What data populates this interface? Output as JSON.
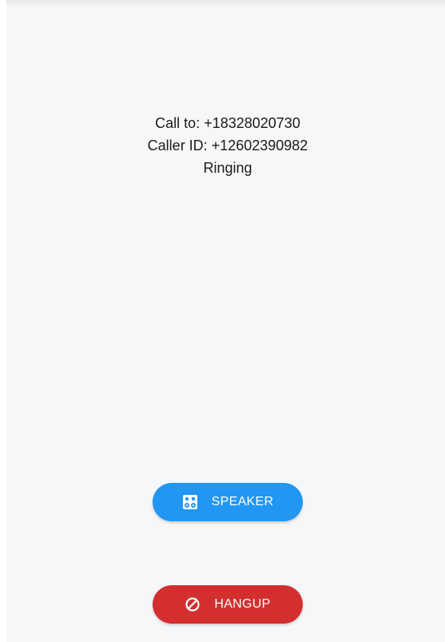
{
  "call": {
    "call_to": "Call to: +18328020730",
    "caller_id": "Caller ID: +12602390982",
    "status": "Ringing"
  },
  "buttons": {
    "speaker": {
      "label": "SPEAKER",
      "icon": "speaker-icon",
      "color": "#2196f3"
    },
    "hangup": {
      "label": "HANGUP",
      "icon": "block-icon",
      "color": "#d32f2f"
    }
  },
  "colors": {
    "background": "#f6f7f9",
    "text": "#1b1b1b"
  }
}
